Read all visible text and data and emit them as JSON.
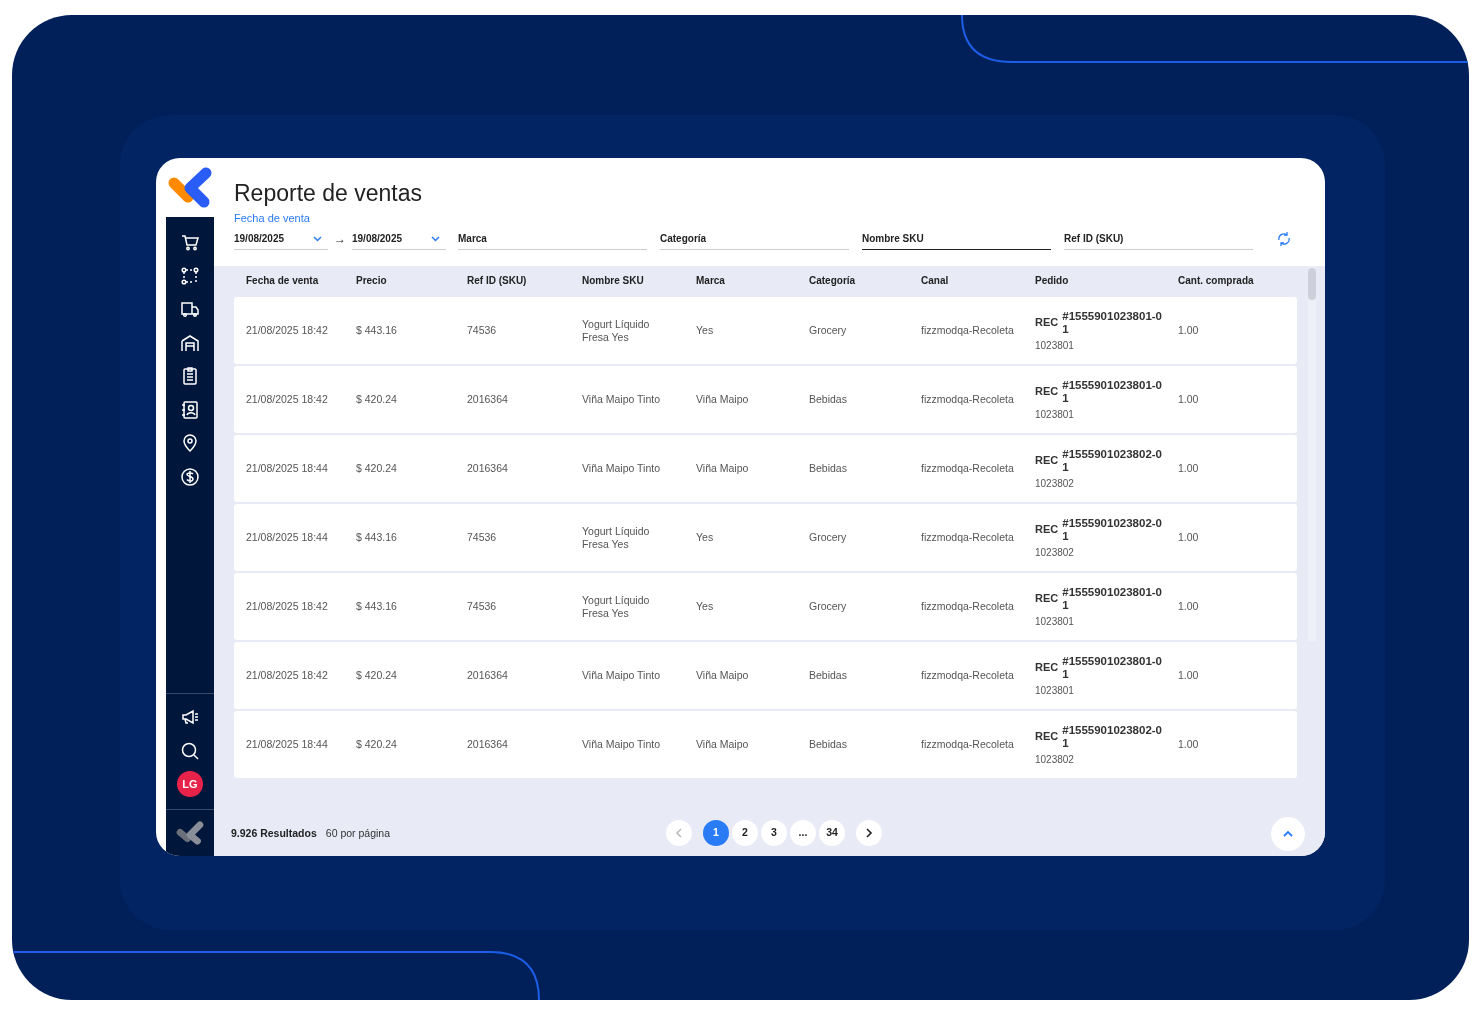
{
  "title": "Reporte de ventas",
  "filters": {
    "date_label": "Fecha de venta",
    "date_from": "19/08/2025",
    "date_to": "19/08/2025",
    "arrow": "→",
    "fields": [
      {
        "label": "Marca",
        "focused": false
      },
      {
        "label": "Categoría",
        "focused": false
      },
      {
        "label": "Nombre SKU",
        "focused": true
      },
      {
        "label": "Ref ID (SKU)",
        "focused": false
      }
    ]
  },
  "table": {
    "columns": [
      "Fecha de venta",
      "Precio",
      "Ref ID (SKU)",
      "Nombre SKU",
      "Marca",
      "Categoría",
      "Canal",
      "Pedido",
      "Cant. comprada"
    ],
    "rows": [
      {
        "fecha": "21/08/2025 18:42",
        "precio": "$ 443.16",
        "ref": "74536",
        "nombre": "Yogurt Líquido Fresa Yes",
        "marca": "Yes",
        "categoria": "Grocery",
        "canal": "fizzmodqa-Recoleta",
        "pedido_tag": "REC",
        "pedido": "#1555901023801-01",
        "pedido_sub": "1023801",
        "cantidad": "1.00"
      },
      {
        "fecha": "21/08/2025 18:42",
        "precio": "$ 420.24",
        "ref": "2016364",
        "nombre": "Viña Maipo Tinto",
        "marca": "Viña Maipo",
        "categoria": "Bebidas",
        "canal": "fizzmodqa-Recoleta",
        "pedido_tag": "REC",
        "pedido": "#1555901023801-01",
        "pedido_sub": "1023801",
        "cantidad": "1.00"
      },
      {
        "fecha": "21/08/2025 18:44",
        "precio": "$ 420.24",
        "ref": "2016364",
        "nombre": "Viña Maipo Tinto",
        "marca": "Viña Maipo",
        "categoria": "Bebidas",
        "canal": "fizzmodqa-Recoleta",
        "pedido_tag": "REC",
        "pedido": "#1555901023802-01",
        "pedido_sub": "1023802",
        "cantidad": "1.00"
      },
      {
        "fecha": "21/08/2025 18:44",
        "precio": "$ 443.16",
        "ref": "74536",
        "nombre": "Yogurt Líquido Fresa Yes",
        "marca": "Yes",
        "categoria": "Grocery",
        "canal": "fizzmodqa-Recoleta",
        "pedido_tag": "REC",
        "pedido": "#1555901023802-01",
        "pedido_sub": "1023802",
        "cantidad": "1.00"
      },
      {
        "fecha": "21/08/2025 18:42",
        "precio": "$ 443.16",
        "ref": "74536",
        "nombre": "Yogurt Líquido Fresa Yes",
        "marca": "Yes",
        "categoria": "Grocery",
        "canal": "fizzmodqa-Recoleta",
        "pedido_tag": "REC",
        "pedido": "#1555901023801-01",
        "pedido_sub": "1023801",
        "cantidad": "1.00"
      },
      {
        "fecha": "21/08/2025 18:42",
        "precio": "$ 420.24",
        "ref": "2016364",
        "nombre": "Viña Maipo Tinto",
        "marca": "Viña Maipo",
        "categoria": "Bebidas",
        "canal": "fizzmodqa-Recoleta",
        "pedido_tag": "REC",
        "pedido": "#1555901023801-01",
        "pedido_sub": "1023801",
        "cantidad": "1.00"
      },
      {
        "fecha": "21/08/2025 18:44",
        "precio": "$ 420.24",
        "ref": "2016364",
        "nombre": "Viña Maipo Tinto",
        "marca": "Viña Maipo",
        "categoria": "Bebidas",
        "canal": "fizzmodqa-Recoleta",
        "pedido_tag": "REC",
        "pedido": "#1555901023802-01",
        "pedido_sub": "1023802",
        "cantidad": "1.00"
      }
    ]
  },
  "footer": {
    "results": "9.926 Resultados",
    "per_page": "60 por página",
    "pages": [
      {
        "label": "1",
        "selected": true
      },
      {
        "label": "2",
        "selected": false
      },
      {
        "label": "3",
        "selected": false
      },
      {
        "label": "...",
        "selected": false
      },
      {
        "label": "34",
        "selected": false
      }
    ],
    "prev_disabled": true,
    "next_disabled": false
  },
  "sidebar": {
    "top": [
      {
        "kind": "cart"
      },
      {
        "kind": "route"
      },
      {
        "kind": "truck"
      },
      {
        "kind": "warehouse"
      },
      {
        "kind": "clipboard"
      },
      {
        "kind": "contacts"
      },
      {
        "kind": "pin"
      },
      {
        "kind": "dollar"
      }
    ],
    "bottom": [
      {
        "kind": "megaphone"
      },
      {
        "kind": "search"
      }
    ],
    "avatar": "LG"
  }
}
